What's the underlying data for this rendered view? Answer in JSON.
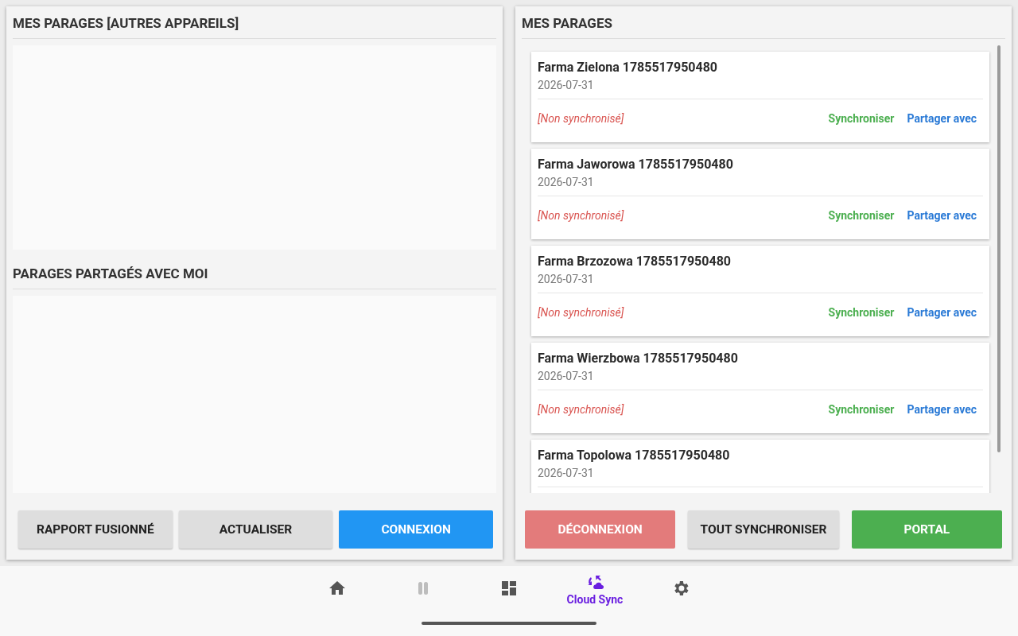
{
  "left_panel": {
    "sections": [
      {
        "title": "MES PARAGES [AUTRES APPAREILS]"
      },
      {
        "title": "PARAGES PARTAGÉS AVEC MOI"
      }
    ],
    "buttons": [
      {
        "label": "RAPPORT FUSIONNÉ",
        "kind": "neutral"
      },
      {
        "label": "ACTUALISER",
        "kind": "neutral"
      },
      {
        "label": "CONNEXION",
        "kind": "primary"
      }
    ]
  },
  "right_panel": {
    "title": "MES PARAGES",
    "cards": [
      {
        "name": "Farma Zielona 1785517950480",
        "date": "2026-07-31",
        "status": "[Non synchronisé]",
        "actions": [
          {
            "label": "Synchroniser",
            "kind": "sync"
          },
          {
            "label": "Partager avec",
            "kind": "share"
          }
        ]
      },
      {
        "name": "Farma Jaworowa 1785517950480",
        "date": "2026-07-31",
        "status": "[Non synchronisé]",
        "actions": [
          {
            "label": "Synchroniser",
            "kind": "sync"
          },
          {
            "label": "Partager avec",
            "kind": "share"
          }
        ]
      },
      {
        "name": "Farma Brzozowa 1785517950480",
        "date": "2026-07-31",
        "status": "[Non synchronisé]",
        "actions": [
          {
            "label": "Synchroniser",
            "kind": "sync"
          },
          {
            "label": "Partager avec",
            "kind": "share"
          }
        ]
      },
      {
        "name": "Farma Wierzbowa 1785517950480",
        "date": "2026-07-31",
        "status": "[Non synchronisé]",
        "actions": [
          {
            "label": "Synchroniser",
            "kind": "sync"
          },
          {
            "label": "Partager avec",
            "kind": "share"
          }
        ]
      },
      {
        "name": "Farma Topolowa 1785517950480",
        "date": "2026-07-31"
      }
    ],
    "buttons": [
      {
        "label": "DÉCONNEXION",
        "kind": "danger"
      },
      {
        "label": "TOUT SYNCHRONISER",
        "kind": "neutral"
      },
      {
        "label": "PORTAL",
        "kind": "success"
      }
    ]
  },
  "bottom_nav": [
    {
      "kind": "home",
      "selected": false,
      "disabled": false
    },
    {
      "kind": "pause",
      "selected": false,
      "disabled": true
    },
    {
      "kind": "dashboard",
      "selected": false,
      "disabled": false
    },
    {
      "kind": "cloud-sync",
      "selected": true,
      "disabled": false,
      "label": "Cloud Sync"
    },
    {
      "kind": "settings",
      "selected": false,
      "disabled": false
    }
  ]
}
